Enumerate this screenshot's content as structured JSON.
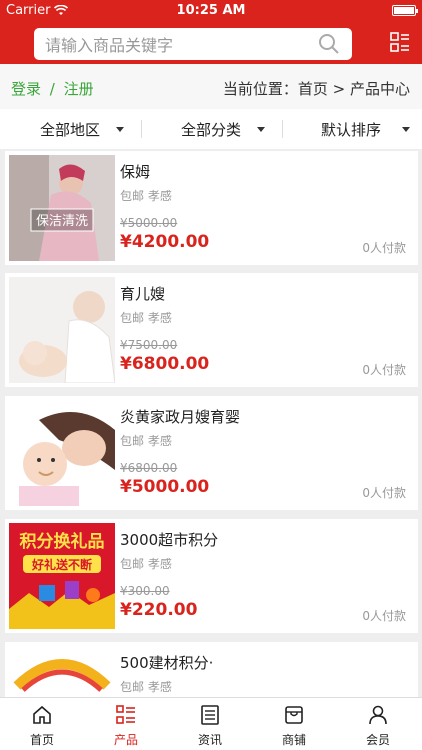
{
  "status_bar": {
    "carrier": "Carrier",
    "time": "10:25 AM"
  },
  "search": {
    "placeholder": "请输入商品关键字"
  },
  "breadcrumb": {
    "login": "登录",
    "separator": "/",
    "register": "注册",
    "location": "当前位置：首页 > 产品中心"
  },
  "filters": [
    {
      "label": "全部地区"
    },
    {
      "label": "全部分类"
    },
    {
      "label": "默认排序"
    }
  ],
  "products": [
    {
      "name": "保姆",
      "tags": "包邮 孝感",
      "old_price": "¥5000.00",
      "price": "¥4200.00",
      "paid": "0人付款",
      "image_text": "保洁清洗"
    },
    {
      "name": "育儿嫂",
      "tags": "包邮 孝感",
      "old_price": "¥7500.00",
      "price": "¥6800.00",
      "paid": "0人付款"
    },
    {
      "name": "炎黄家政月嫂育婴",
      "tags": "包邮 孝感",
      "old_price": "¥6800.00",
      "price": "¥5000.00",
      "paid": "0人付款"
    },
    {
      "name": "3000超市积分",
      "tags": "包邮 孝感",
      "old_price": "¥300.00",
      "price": "¥220.00",
      "paid": "0人付款",
      "image_text_1": "积分换礼品",
      "image_text_2": "好礼送不断"
    },
    {
      "name": "500建材积分·",
      "tags": "包邮 孝感"
    }
  ],
  "tabs": [
    {
      "label": "首页",
      "icon": "home-icon"
    },
    {
      "label": "产品",
      "icon": "list-icon"
    },
    {
      "label": "资讯",
      "icon": "news-icon"
    },
    {
      "label": "商铺",
      "icon": "shop-icon"
    },
    {
      "label": "会员",
      "icon": "user-icon"
    }
  ],
  "colors": {
    "brand": "#d9231c",
    "login_green": "#3aa63a",
    "muted": "#999999"
  }
}
